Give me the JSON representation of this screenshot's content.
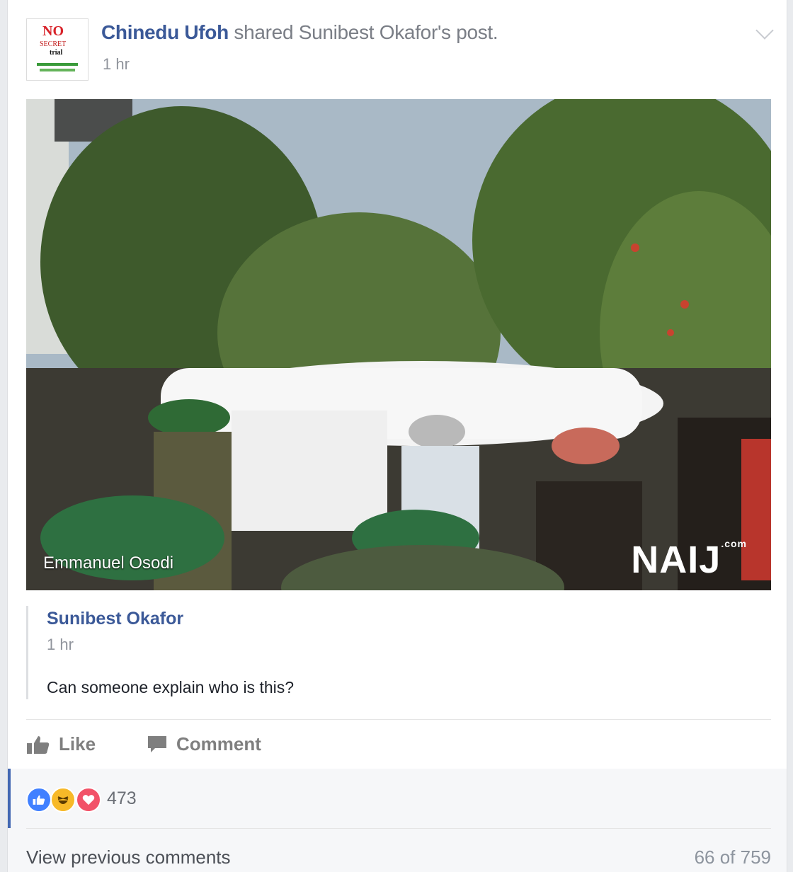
{
  "post": {
    "sharer_name": "Chinedu Ufoh",
    "shared_text": " shared Sunibest Okafor's post.",
    "time": "1 hr",
    "avatar_logo_no": "NO",
    "avatar_logo_secret": "SECRET",
    "avatar_logo_trial": "trial"
  },
  "photo": {
    "credit": "Emmanuel Osodi",
    "watermark": "NAIJ",
    "watermark_suffix": ".com"
  },
  "original_post": {
    "author": "Sunibest Okafor",
    "time": "1 hr",
    "text": "Can someone explain who is this?"
  },
  "actions": {
    "like_label": "Like",
    "comment_label": "Comment"
  },
  "reactions": {
    "count": "473",
    "icons": [
      "like-icon",
      "haha-icon",
      "love-icon"
    ],
    "colors": {
      "like": "#4080ff",
      "haha": "#f7b928",
      "love": "#f25268"
    }
  },
  "comments": {
    "view_previous_label": "View previous comments",
    "page_count": "66 of 759"
  }
}
